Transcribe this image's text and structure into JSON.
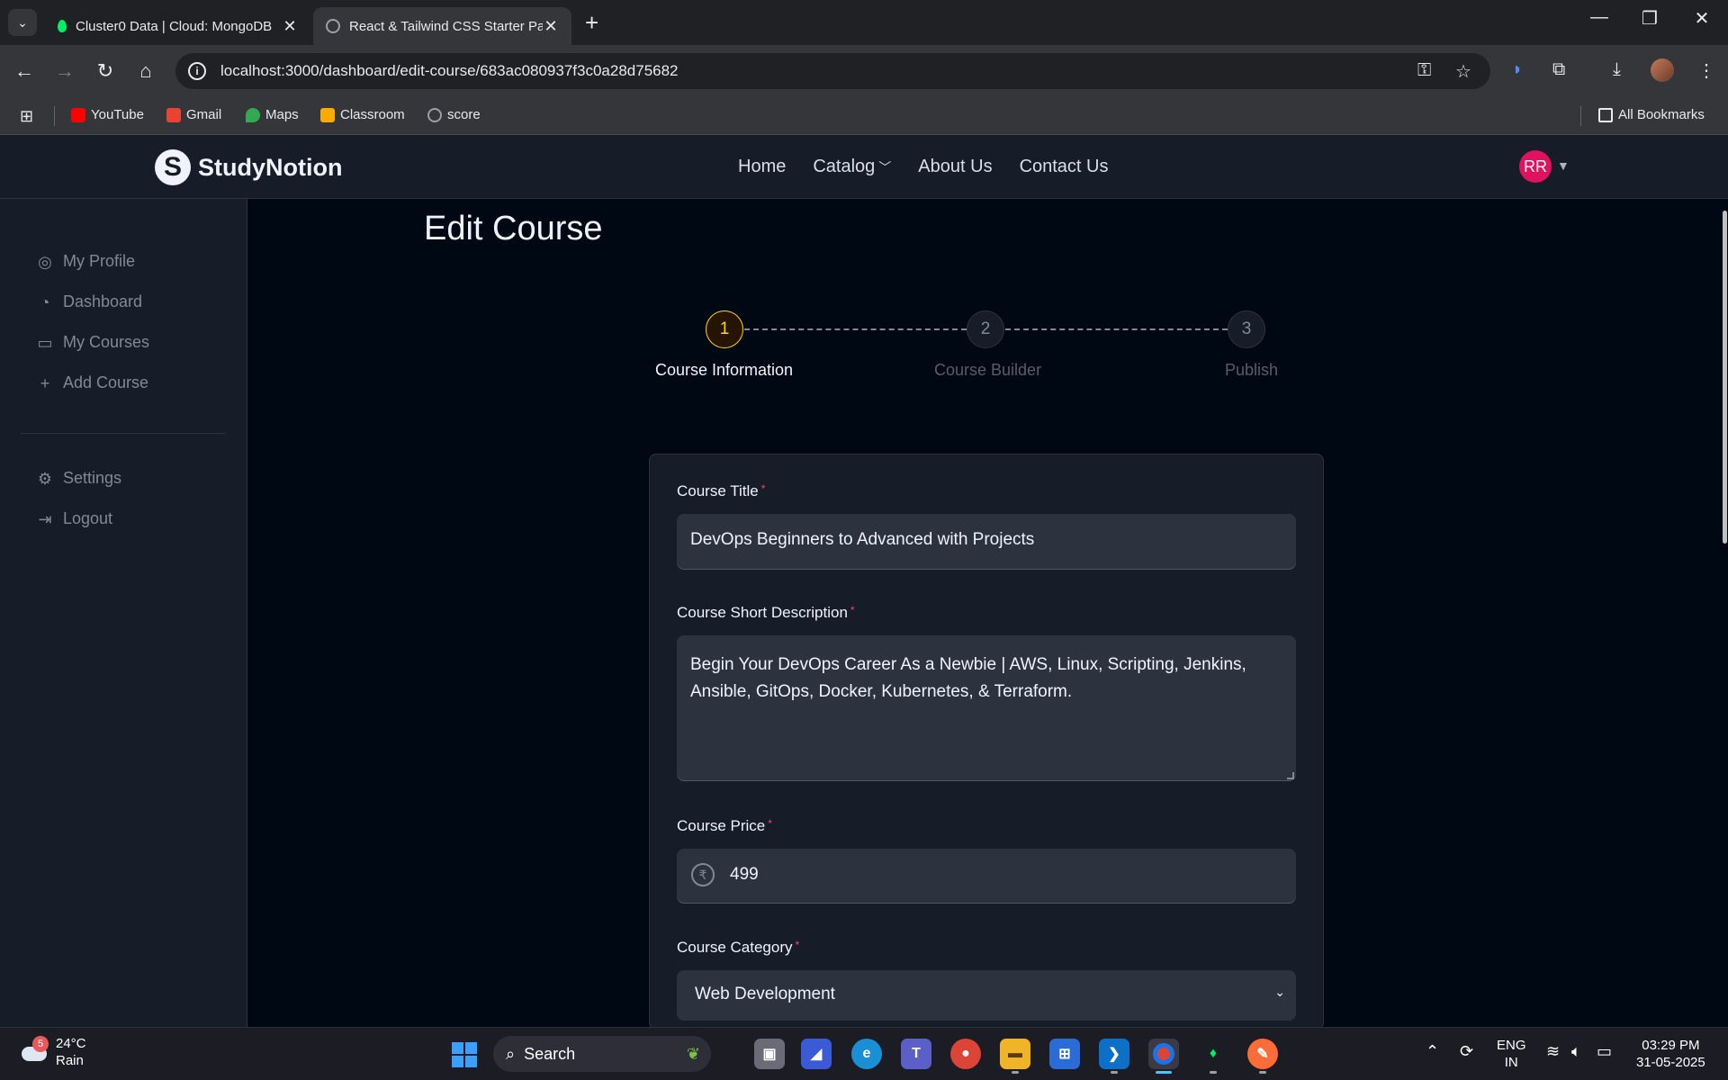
{
  "browser": {
    "tabs": [
      {
        "title": "Cluster0 Data | Cloud: MongoDB",
        "active": false
      },
      {
        "title": "React & Tailwind CSS Starter Pack",
        "active": true
      }
    ],
    "new_tab_icon": "plus-icon",
    "url": "localhost:3000/dashboard/edit-course/683ac080937f3c0a28d75682",
    "bookmarks": [
      {
        "label": "YouTube",
        "color": "#ff0000"
      },
      {
        "label": "Gmail",
        "color": "#ea4335"
      },
      {
        "label": "Maps",
        "color": "#34a853"
      },
      {
        "label": "Classroom",
        "color": "#f9ab00"
      },
      {
        "label": "score",
        "color": "#9aa0a6"
      }
    ],
    "all_bookmarks": "All Bookmarks"
  },
  "app": {
    "brand": "StudyNotion",
    "brand_mark": "S",
    "nav": [
      {
        "label": "Home"
      },
      {
        "label": "Catalog"
      },
      {
        "label": "About Us"
      },
      {
        "label": "Contact Us"
      }
    ],
    "avatar_initials": "RR",
    "sidebar": {
      "items": [
        {
          "label": "My Profile",
          "icon": "user-circle-icon"
        },
        {
          "label": "Dashboard",
          "icon": "gauge-icon"
        },
        {
          "label": "My Courses",
          "icon": "monitor-icon"
        },
        {
          "label": "Add Course",
          "icon": "plus-icon"
        }
      ],
      "bottom_items": [
        {
          "label": "Settings",
          "icon": "gear-icon"
        },
        {
          "label": "Logout",
          "icon": "logout-icon"
        }
      ]
    },
    "page_title": "Edit Course",
    "steps": [
      {
        "number": "1",
        "label": "Course Information",
        "state": "active"
      },
      {
        "number": "2",
        "label": "Course Builder",
        "state": "todo"
      },
      {
        "number": "3",
        "label": "Publish",
        "state": "todo"
      }
    ],
    "form": {
      "title_label": "Course Title",
      "title_value": "DevOps Beginners to Advanced with Projects",
      "desc_label": "Course Short Description",
      "desc_value": "Begin Your DevOps Career As a Newbie | AWS, Linux, Scripting, Jenkins, Ansible, GitOps, Docker, Kubernetes, & Terraform.",
      "price_label": "Course Price",
      "price_value": "499",
      "price_symbol": "₹",
      "category_label": "Course Category",
      "category_value": "Web Development",
      "required_mark": "*"
    }
  },
  "taskbar": {
    "weather_temp": "24°C",
    "weather_desc": "Rain",
    "weather_badge": "5",
    "search_label": "Search",
    "lang_top": "ENG",
    "lang_bottom": "IN",
    "time": "03:29 PM",
    "date": "31-05-2025"
  }
}
